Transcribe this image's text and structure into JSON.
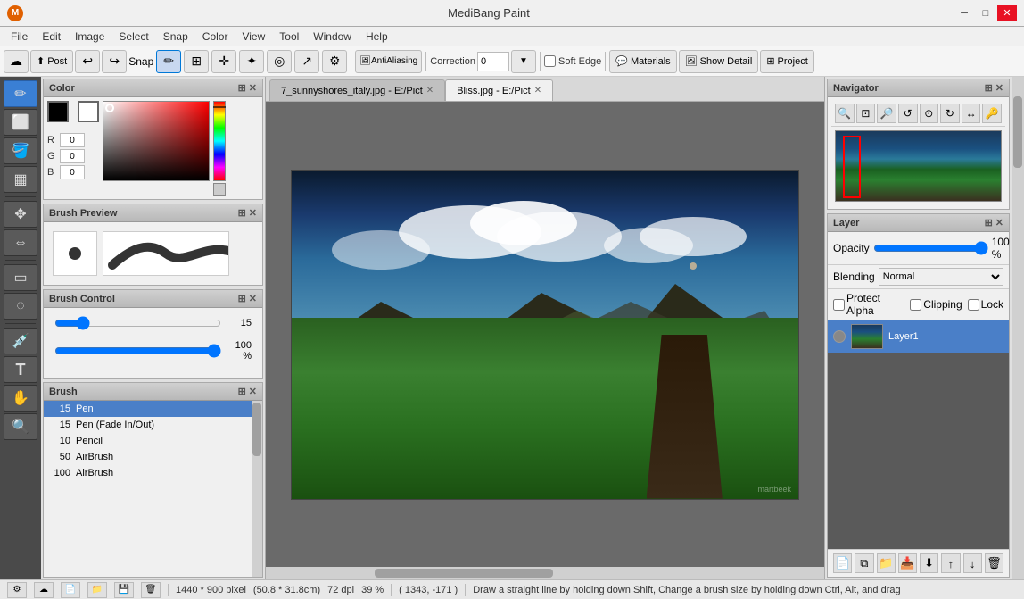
{
  "titlebar": {
    "title": "MediBang Paint",
    "app_icon": "M",
    "minimize": "─",
    "maximize": "□",
    "close": "✕"
  },
  "menubar": {
    "items": [
      "File",
      "Edit",
      "Image",
      "Select",
      "Snap",
      "Color",
      "View",
      "Tool",
      "Window",
      "Help"
    ]
  },
  "toolbar": {
    "post_label": "Post",
    "snap_label": "Snap",
    "antialiasing_label": "AntiAliasing",
    "correction_label": "Correction",
    "correction_value": "0",
    "soft_edge_label": "Soft Edge",
    "materials_label": "Materials",
    "show_detail_label": "Show Detail",
    "project_label": "Project"
  },
  "tabs": [
    {
      "label": "7_sunnyshores_italy.jpg - E:/Pict",
      "active": false
    },
    {
      "label": "Bliss.jpg - E:/Pict",
      "active": true
    }
  ],
  "color_panel": {
    "title": "Color",
    "r_label": "R",
    "r_value": "0",
    "g_label": "G",
    "g_value": "0",
    "b_label": "B",
    "b_value": "0"
  },
  "brush_preview_panel": {
    "title": "Brush Preview"
  },
  "brush_control_panel": {
    "title": "Brush Control",
    "size_value": "15",
    "opacity_value": "100 %"
  },
  "brush_list_panel": {
    "title": "Brush",
    "brushes": [
      {
        "size": "15",
        "name": "Pen",
        "active": true
      },
      {
        "size": "15",
        "name": "Pen (Fade In/Out)",
        "active": false
      },
      {
        "size": "10",
        "name": "Pencil",
        "active": false
      },
      {
        "size": "50",
        "name": "AirBrush",
        "active": false
      },
      {
        "size": "100",
        "name": "AirBrush",
        "active": false
      }
    ]
  },
  "navigator_panel": {
    "title": "Navigator"
  },
  "layer_panel": {
    "title": "Layer",
    "opacity_label": "Opacity",
    "opacity_value": "100 %",
    "blending_label": "Blending",
    "blending_value": "Normal",
    "protect_alpha_label": "Protect Alpha",
    "clipping_label": "Clipping",
    "lock_label": "Lock",
    "layers": [
      {
        "name": "Layer1",
        "active": true
      }
    ]
  },
  "statusbar": {
    "size": "1440 * 900 pixel",
    "cm": "(50.8 * 31.8cm)",
    "dpi": "72 dpi",
    "zoom": "39 %",
    "coords": "( 1343, -171 )",
    "hint": "Draw a straight line by holding down Shift, Change a brush size by holding down Ctrl, Alt, and drag"
  },
  "icons": {
    "arrow_up": "↑",
    "undo": "↩",
    "redo": "↪",
    "expand": "⊞",
    "collapse": "⊟",
    "close": "✕",
    "gear": "⚙",
    "zoom_in": "🔍",
    "zoom_out": "🔎",
    "fit": "⊡",
    "layer_add": "+",
    "layer_del": "−",
    "folder": "📁",
    "copy": "⧉",
    "merge": "⬇"
  }
}
